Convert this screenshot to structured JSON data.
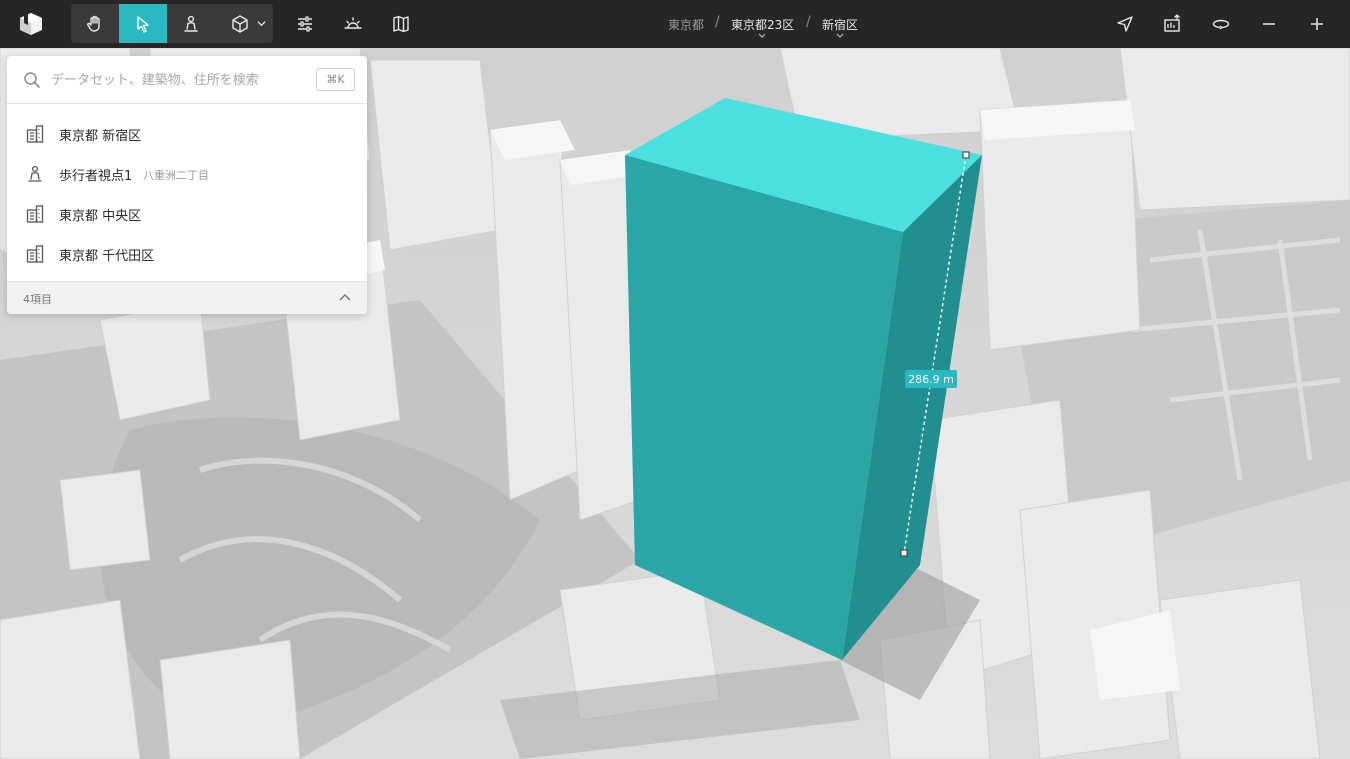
{
  "search": {
    "placeholder": "データセット、建築物、住所を検索",
    "shortcut": "⌘K"
  },
  "results": [
    {
      "label": "東京都 新宿区",
      "icon": "building-icon"
    },
    {
      "label": "歩行者視点1",
      "sub": "八重洲二丁目",
      "icon": "pedestrian-icon"
    },
    {
      "label": "東京都 中央区",
      "icon": "building-icon"
    },
    {
      "label": "東京都 千代田区",
      "icon": "building-icon"
    }
  ],
  "footer": {
    "count": "4項目"
  },
  "breadcrumb": {
    "root": "東京都",
    "level2": "東京都23区",
    "level3": "新宿区"
  },
  "measurement": {
    "label": "286.9 m"
  },
  "colors": {
    "accent": "#2ab8c2",
    "toolbar_bg": "#262626",
    "box_top": "#4be0e0",
    "box_front": "#2aa6a6",
    "box_side": "#218f8f"
  },
  "tools": [
    {
      "name": "hand-icon"
    },
    {
      "name": "pointer-icon",
      "active": true
    },
    {
      "name": "pedestrian-icon"
    },
    {
      "name": "cube-icon"
    }
  ],
  "right_tools": [
    "navigate-icon",
    "screenshot-icon",
    "orbit-icon",
    "zoom-out-icon",
    "zoom-in-icon"
  ]
}
